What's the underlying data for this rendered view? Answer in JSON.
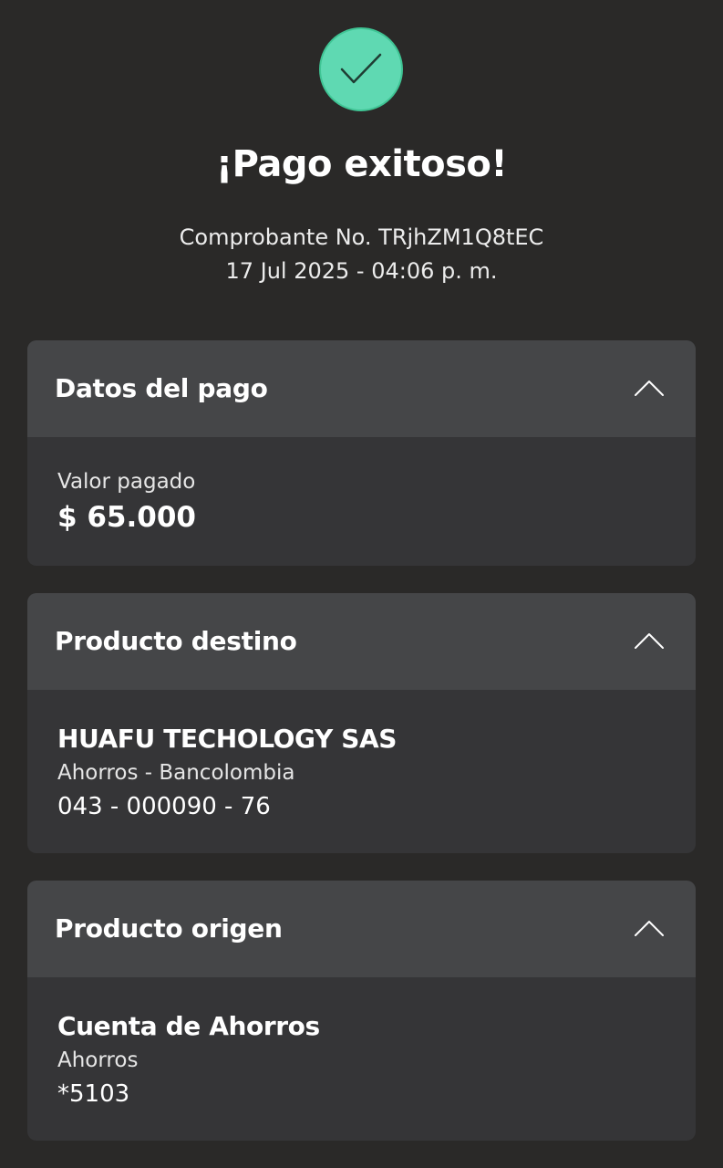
{
  "header": {
    "icon": "checkmark-icon",
    "title": "¡Pago exitoso!",
    "receipt_line": "Comprobante No. TRjhZM1Q8tEC",
    "datetime": "17 Jul 2025 - 04:06 p. m."
  },
  "colors": {
    "background": "#2a2928",
    "card_header": "#454648",
    "card_body": "#353537",
    "success_green": "#5fd9b2"
  },
  "sections": {
    "payment": {
      "title": "Datos del pago",
      "expand_icon": "chevron-up-icon",
      "label": "Valor pagado",
      "value": "$ 65.000"
    },
    "destination": {
      "title": "Producto destino",
      "expand_icon": "chevron-up-icon",
      "name": "HUAFU TECHOLOGY SAS",
      "type": "Ahorros - Bancolombia",
      "account": "043 - 000090 - 76"
    },
    "origin": {
      "title": "Producto origen",
      "expand_icon": "chevron-up-icon",
      "name": "Cuenta de Ahorros",
      "type": "Ahorros",
      "account": "*5103"
    }
  }
}
